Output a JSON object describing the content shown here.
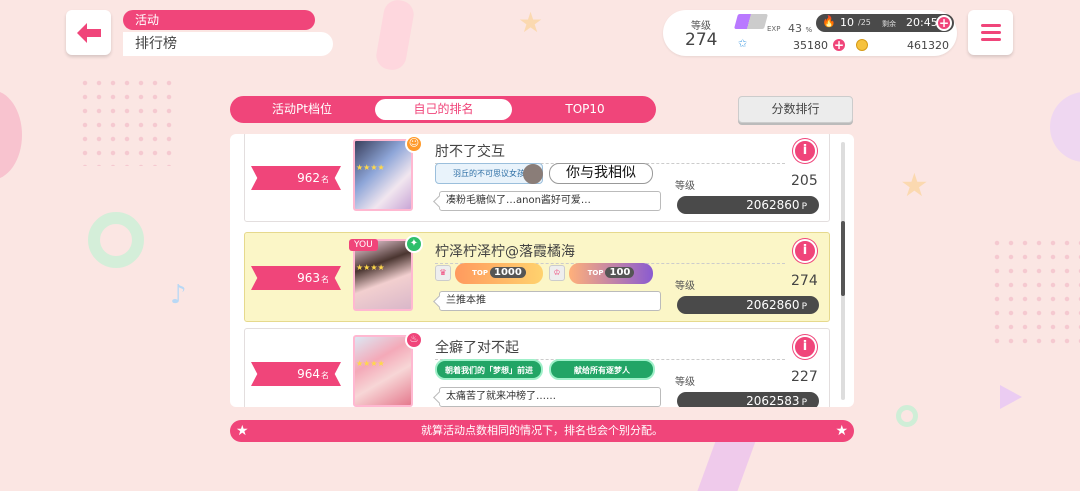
{
  "header": {
    "category": "活动",
    "title": "排行榜"
  },
  "status": {
    "level_label": "等级",
    "level": "274",
    "exp_label": "EXP",
    "exp_value": "43",
    "exp_unit": "%",
    "exp_fraction": 0.43,
    "stamina": "10",
    "stamina_max": "/25",
    "remain_label": "剩余",
    "remain_time": "20:45",
    "stars": "35180",
    "coins": "461320"
  },
  "tabs": [
    {
      "label": "活动Pt档位",
      "active": false
    },
    {
      "label": "自己的排名",
      "active": true
    },
    {
      "label": "TOP10",
      "active": false
    }
  ],
  "sort_button": "分数排行",
  "rank_unit": "名",
  "level_label": "等级",
  "pts_unit": "P",
  "entries": [
    {
      "rank": "962",
      "name": "肘不了交互",
      "tag1": "羽丘的不可思议女孩",
      "tag2": "你与我相似",
      "comment": "凑粉毛糖似了…anon酱好可爱…",
      "level": "205",
      "points": "2062860"
    },
    {
      "rank": "963",
      "you": "YOU",
      "name": "柠泽柠泽柠@落霞橘海",
      "badge1": "1000",
      "badge2": "100",
      "badge_top": "TOP",
      "comment": "兰推本推",
      "level": "274",
      "points": "2062860"
    },
    {
      "rank": "964",
      "name": "全癖了对不起",
      "tag1": "朝着我们的「梦想」前进",
      "tag2": "献给所有逐梦人",
      "comment": "太痛苦了就来冲榜了……",
      "level": "227",
      "points": "2062583"
    }
  ],
  "footer": "就算活动点数相同的情况下，排名也会个别分配。",
  "colors": {
    "accent": "#f0457a",
    "background": "#fbe6e3",
    "highlight_row": "#fbf6c7",
    "dark_box": "#4a4a4a"
  },
  "icons": {
    "back": "arrow-left-icon",
    "menu": "hamburger-icon",
    "info": "info-icon",
    "stamina": "flame-icon",
    "star": "star-icon",
    "coin": "coin-icon"
  }
}
